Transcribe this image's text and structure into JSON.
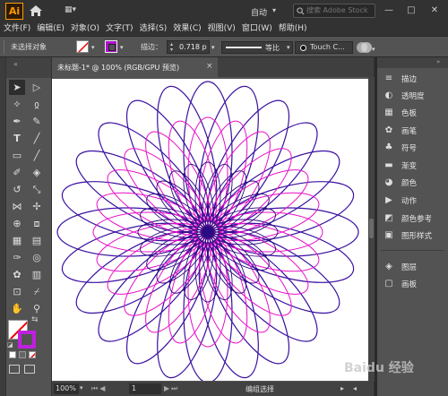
{
  "app": {
    "logo": "Ai",
    "workspace": "自动",
    "search_placeholder": "搜索 Adobe Stock",
    "window_buttons": [
      "—",
      "□",
      "✕"
    ]
  },
  "menu": [
    "文件(F)",
    "编辑(E)",
    "对象(O)",
    "文字(T)",
    "选择(S)",
    "效果(C)",
    "视图(V)",
    "窗口(W)",
    "帮助(H)"
  ],
  "control": {
    "selection": "未选择对象",
    "stroke_label": "描边：",
    "stroke_value": "0.718 p",
    "line_label": "等比",
    "brush_label": "Touch C..."
  },
  "document": {
    "tab_title": "未标题-1* @ 100% (RGB/GPU 预览)",
    "close": "×"
  },
  "status": {
    "zoom": "100%",
    "artboard": "1",
    "text": "编组选择"
  },
  "right_panel": {
    "items": [
      {
        "icon": "stroke-icon",
        "label": "描边"
      },
      {
        "icon": "transparency-icon",
        "label": "透明度"
      },
      {
        "icon": "swatches-icon",
        "label": "色板"
      },
      {
        "icon": "brushes-icon",
        "label": "画笔"
      },
      {
        "icon": "symbols-icon",
        "label": "符号"
      },
      {
        "icon": "gradient-icon",
        "label": "渐变"
      },
      {
        "icon": "color-icon",
        "label": "颜色"
      },
      {
        "icon": "actions-icon",
        "label": "动作"
      },
      {
        "icon": "color-guide-icon",
        "label": "颜色参考"
      },
      {
        "icon": "graphic-styles-icon",
        "label": "图形样式"
      },
      {
        "icon": "layers-icon",
        "label": "图层"
      },
      {
        "icon": "artboards-icon",
        "label": "画板"
      }
    ]
  },
  "artwork": {
    "outer_color": "#3a10a0",
    "inner_color": "#e810c8",
    "core_color": "#2a0a80"
  },
  "watermark": "Baidu 经验"
}
